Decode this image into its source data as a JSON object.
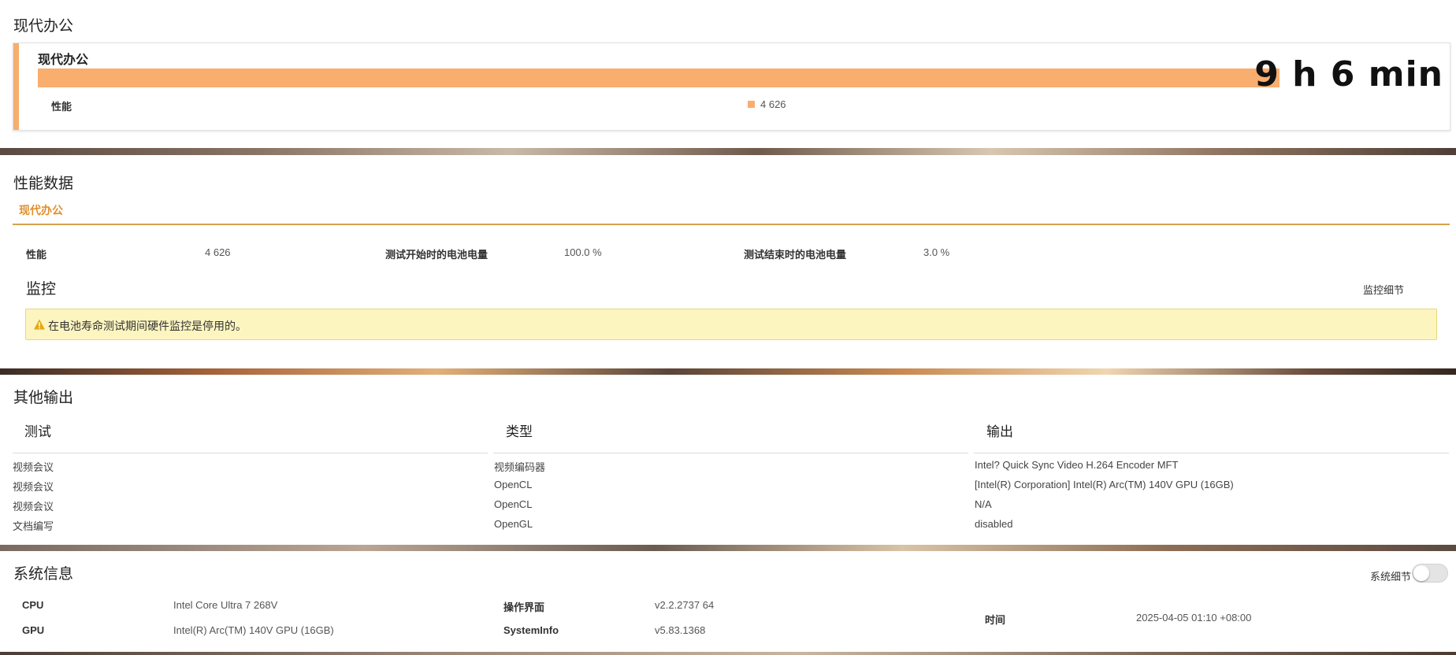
{
  "colors": {
    "accent_orange": "#f9ad6e",
    "tab_orange": "#e0902e",
    "warning_bg": "#fdf5c0"
  },
  "summary": {
    "section_title": "现代办公",
    "card_title": "现代办公",
    "bar_fill_fraction": 1.0,
    "result": "9 h 6 min",
    "legend_name": "性能",
    "legend_value": "4 626"
  },
  "performance": {
    "section_title": "性能数据",
    "tab_label": "现代办公",
    "fields": [
      {
        "label": "性能",
        "value": "4 626"
      },
      {
        "label": "测试开始时的电池电量",
        "value": "100.0 %"
      },
      {
        "label": "测试结束时的电池电量",
        "value": "3.0 %"
      }
    ],
    "monitor_title": "监控",
    "monitor_details_link": "监控细节",
    "warning_icon": "warning-triangle-icon",
    "warning_text": "在电池寿命测试期间硬件监控是停用的。"
  },
  "other_output": {
    "section_title": "其他输出",
    "headers": [
      "测试",
      "类型",
      "输出"
    ],
    "rows": [
      [
        "视频会议",
        "视频编码器",
        "Intel? Quick Sync Video H.264 Encoder MFT"
      ],
      [
        "视频会议",
        "OpenCL",
        "[Intel(R) Corporation] Intel(R) Arc(TM) 140V GPU (16GB)"
      ],
      [
        "视频会议",
        "OpenCL",
        "N/A"
      ],
      [
        "文档编写",
        "OpenGL",
        "disabled"
      ]
    ]
  },
  "system_info": {
    "section_title": "系统信息",
    "toggle_label": "系统细节",
    "toggle_on": false,
    "items": [
      {
        "label": "CPU",
        "value": "Intel Core Ultra 7 268V"
      },
      {
        "label": "GPU",
        "value": "Intel(R) Arc(TM) 140V GPU (16GB)"
      },
      {
        "label": "操作界面",
        "value": "v2.2.2737 64"
      },
      {
        "label": "SystemInfo",
        "value": "v5.83.1368"
      },
      {
        "label": "时间",
        "value": "2025-04-05 01:10 +08:00"
      }
    ]
  }
}
